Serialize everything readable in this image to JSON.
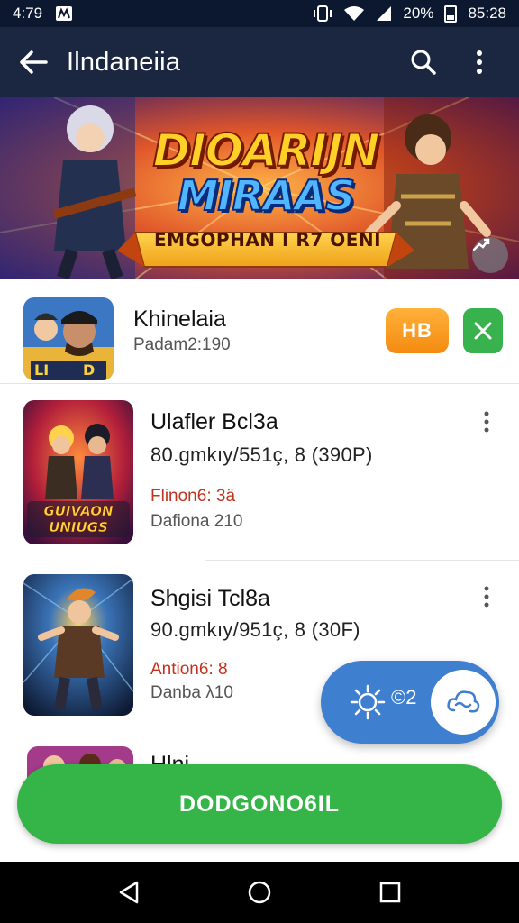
{
  "status_bar": {
    "time": "4:79",
    "battery": "20%",
    "clock": "85:28"
  },
  "app_bar": {
    "title": "Ilndaneiia"
  },
  "banner": {
    "title_line1": "DIOARIJN",
    "title_line2": "MIRAAS",
    "ribbon": "EMGOPHAN I R7 OENI"
  },
  "featured": {
    "title": "Khinelaia",
    "subtitle": "Padam2:190",
    "hd_label": "HB"
  },
  "games": [
    {
      "title": "Ulafler Bcl3a",
      "meta": "80.gmkıy/551ç, 8 (390P)",
      "tag": "Flinon6: 3ä",
      "date": "Dafiona 210",
      "thumb_text": "GUIVAON UNIUGS"
    },
    {
      "title": "Shgisi Tcl8a",
      "meta": "90.gmkıy/951ç, 8 (30F)",
      "tag": "Antion6: 8",
      "date": "Danba λ10"
    }
  ],
  "partial_item": {
    "title": "Hlni"
  },
  "float_pill": {
    "label": "©2"
  },
  "download_button": {
    "label": "DODGONO6IL"
  },
  "colors": {
    "app_bar": "#1b2740",
    "accent_green": "#35b548",
    "pill_blue": "#3f7fd0",
    "hd_orange": "#f48a10"
  }
}
